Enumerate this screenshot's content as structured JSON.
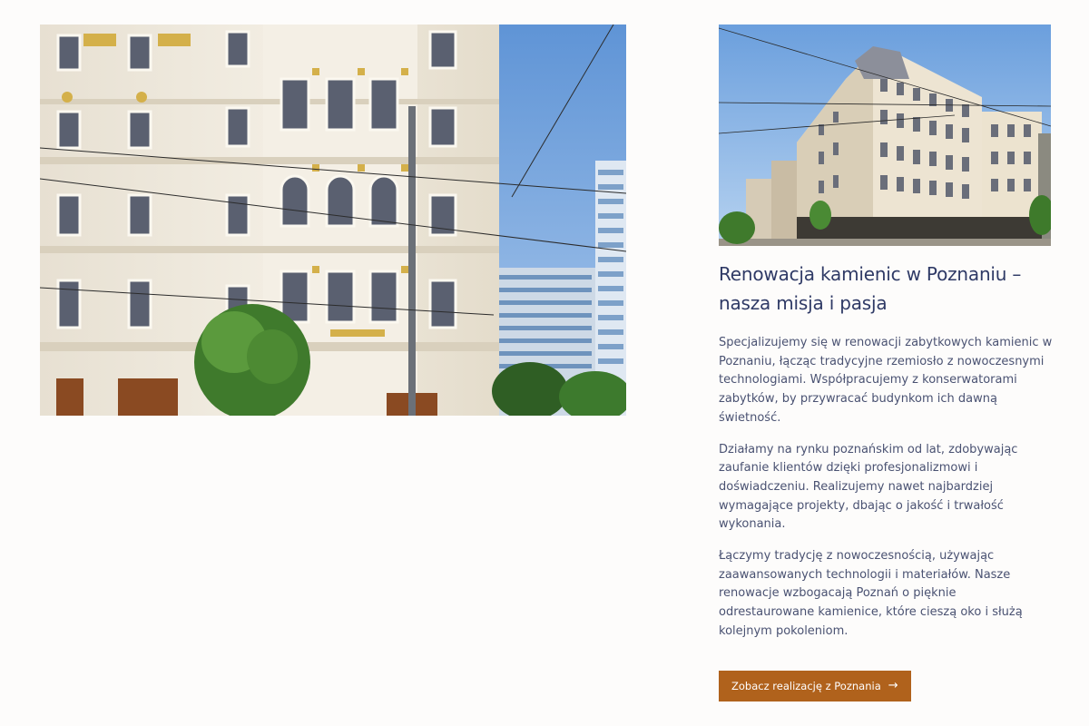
{
  "images": {
    "main_photo": {
      "subject": "kamienica-facade"
    },
    "secondary_photo": {
      "subject": "kamienica-corner-street"
    }
  },
  "section": {
    "heading": "Renowacja kamienic w Poznaniu – nasza misja i pasja",
    "paragraphs": [
      "Specjalizujemy się w renowacji zabytkowych kamienic w Poznaniu, łącząc tradycyjne rzemiosło z nowoczesnymi technologiami. Współpracujemy z konserwatorami zabytków, by przywracać budynkom ich dawną świetność.",
      "Działamy na rynku poznańskim od lat, zdobywając zaufanie klientów dzięki profesjonalizmowi i doświadczeniu. Realizujemy nawet najbardziej wymagające projekty, dbając o jakość i trwałość wykonania.",
      "Łączymy tradycję z nowoczesnością, używając zaawansowanych technologii i materiałów. Nasze renowacje wzbogacają Poznań o pięknie odrestaurowane kamienice, które cieszą oko i służą kolejnym pokoleniom."
    ],
    "cta_label": "Zobacz realizację z Poznania",
    "cta_icon": "arrow-right-icon",
    "accent_color": "#b0621c",
    "heading_color": "#2f3a66"
  }
}
